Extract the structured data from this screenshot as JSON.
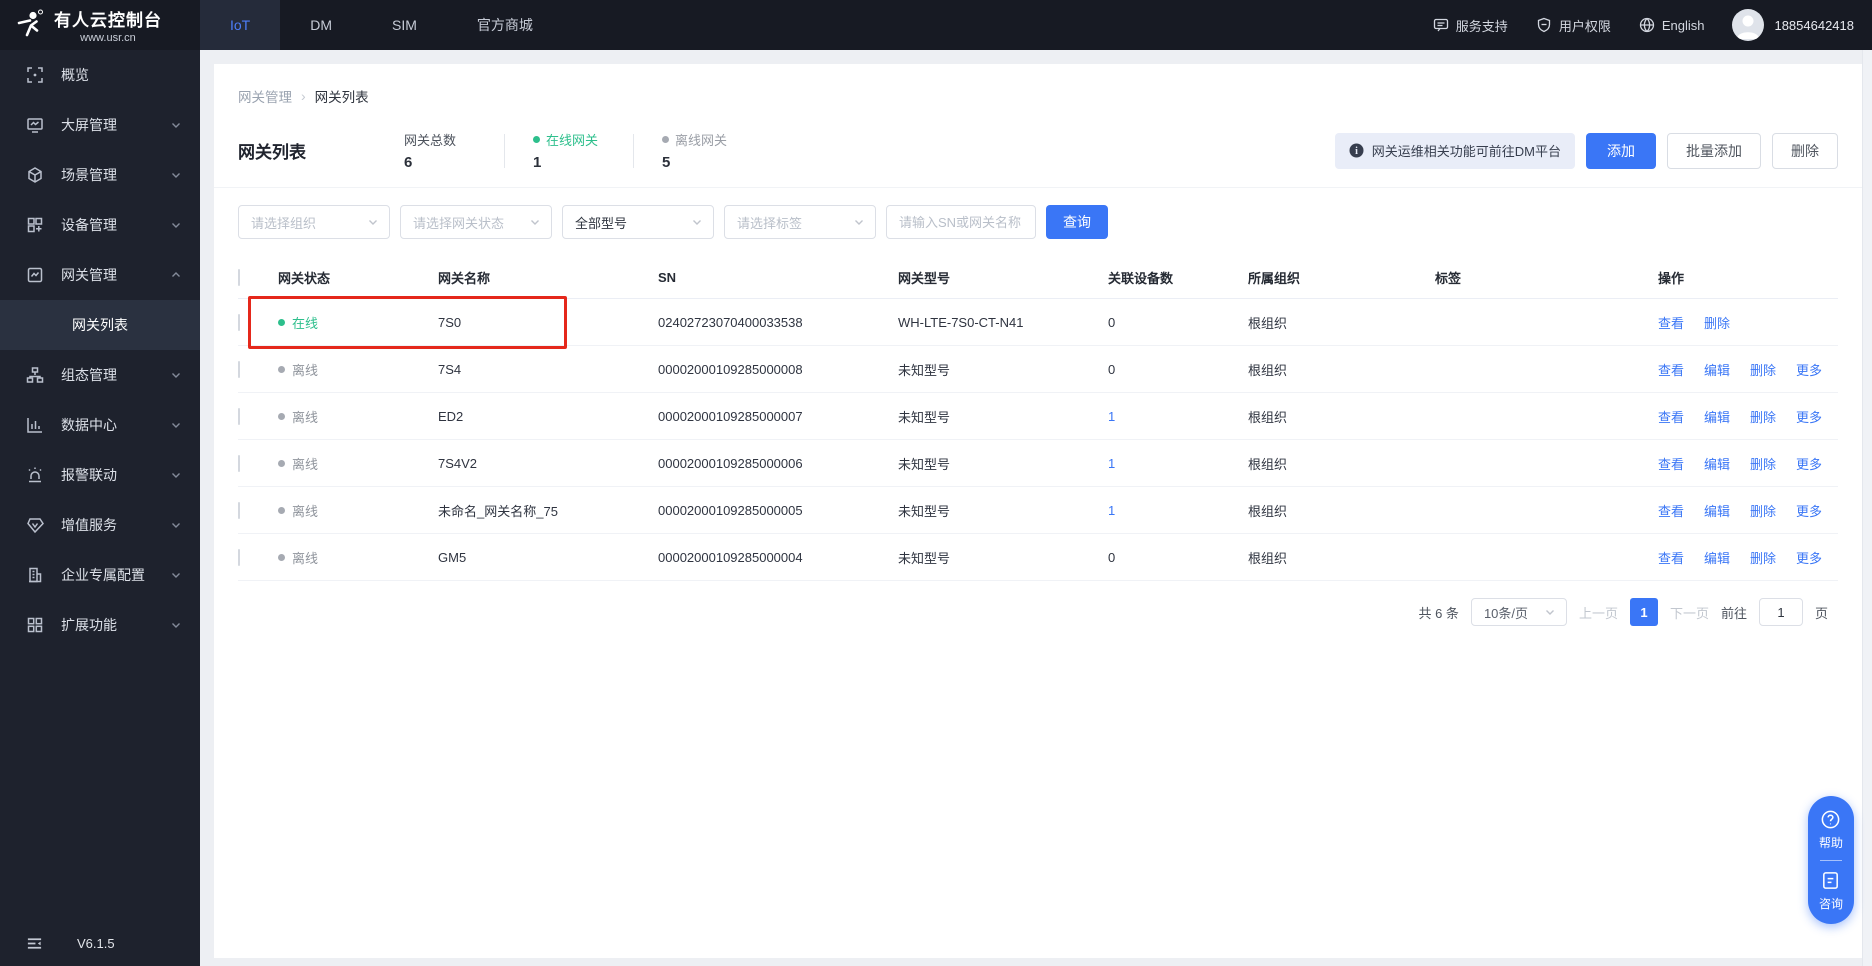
{
  "brand": {
    "title": "有人云控制台",
    "subtitle": "www.usr.cn"
  },
  "topbar": {
    "tabs": [
      {
        "name": "iot",
        "label": "IoT",
        "active": true
      },
      {
        "name": "dm",
        "label": "DM",
        "active": false
      },
      {
        "name": "sim",
        "label": "SIM",
        "active": false
      },
      {
        "name": "mall",
        "label": "官方商城",
        "active": false
      }
    ],
    "links": [
      {
        "name": "service-support",
        "icon": "chat-icon",
        "label": "服务支持"
      },
      {
        "name": "user-permission",
        "icon": "shield-icon",
        "label": "用户权限"
      },
      {
        "name": "language",
        "icon": "globe-icon",
        "label": "English"
      }
    ],
    "user_phone": "18854642418"
  },
  "sidebar": {
    "items": [
      {
        "name": "overview",
        "icon": "overview-icon",
        "label": "概览",
        "chevron": null,
        "submenu": false,
        "active": false
      },
      {
        "name": "screen-mgmt",
        "icon": "screen-icon",
        "label": "大屏管理",
        "chevron": "down",
        "submenu": false,
        "active": false
      },
      {
        "name": "scene-mgmt",
        "icon": "scene-icon",
        "label": "场景管理",
        "chevron": "down",
        "submenu": false,
        "active": false
      },
      {
        "name": "device-mgmt",
        "icon": "device-icon",
        "label": "设备管理",
        "chevron": "down",
        "submenu": false,
        "active": false
      },
      {
        "name": "gateway-mgmt",
        "icon": "gateway-icon",
        "label": "网关管理",
        "chevron": "up",
        "submenu": false,
        "active": false
      },
      {
        "name": "gateway-list",
        "icon": null,
        "label": "网关列表",
        "chevron": null,
        "submenu": true,
        "active": true
      },
      {
        "name": "config-mgmt",
        "icon": "topology-icon",
        "label": "组态管理",
        "chevron": "down",
        "submenu": false,
        "active": false
      },
      {
        "name": "data-center",
        "icon": "data-icon",
        "label": "数据中心",
        "chevron": "down",
        "submenu": false,
        "active": false
      },
      {
        "name": "alarm-linkage",
        "icon": "alarm-icon",
        "label": "报警联动",
        "chevron": "down",
        "submenu": false,
        "active": false
      },
      {
        "name": "value-added",
        "icon": "vas-icon",
        "label": "增值服务",
        "chevron": "down",
        "submenu": false,
        "active": false
      },
      {
        "name": "enterprise-config",
        "icon": "enterprise-icon",
        "label": "企业专属配置",
        "chevron": "down",
        "submenu": false,
        "active": false
      },
      {
        "name": "extensions",
        "icon": "extension-icon",
        "label": "扩展功能",
        "chevron": "down",
        "submenu": false,
        "active": false
      }
    ],
    "version": "V6.1.5"
  },
  "breadcrumb": {
    "parent": "网关管理",
    "current": "网关列表"
  },
  "page": {
    "title": "网关列表",
    "stats": [
      {
        "label": "网关总数",
        "value": "6",
        "dot": null,
        "label_color": "#4c525c"
      },
      {
        "label": "在线网关",
        "value": "1",
        "dot": "#2dbf8c",
        "label_color": "#2dbf8c"
      },
      {
        "label": "离线网关",
        "value": "5",
        "dot": "#a6aab2",
        "label_color": "#9a9ea6"
      }
    ],
    "banner_text": "网关运维相关功能可前往DM平台",
    "add_label": "添加",
    "batch_add_label": "批量添加",
    "delete_label": "删除"
  },
  "filters": {
    "selects": [
      {
        "name": "org-select",
        "value": "请选择组织",
        "is_placeholder": true
      },
      {
        "name": "status-select",
        "value": "请选择网关状态",
        "is_placeholder": true
      },
      {
        "name": "model-select",
        "value": "全部型号",
        "is_placeholder": false
      },
      {
        "name": "tag-select",
        "value": "请选择标签",
        "is_placeholder": true
      }
    ],
    "search_placeholder": "请输入SN或网关名称",
    "query_label": "查询"
  },
  "table": {
    "columns": [
      "网关状态",
      "网关名称",
      "SN",
      "网关型号",
      "关联设备数",
      "所属组织",
      "标签",
      "操作"
    ],
    "rows": [
      {
        "status": "在线",
        "online": true,
        "name": "7S0",
        "sn": "02402723070400033538",
        "model": "WH-LTE-7S0-CT-N41",
        "devices": "0",
        "devices_link": false,
        "org": "根组织",
        "tags": "",
        "actions": [
          "查看",
          "删除"
        ],
        "highlighted": true
      },
      {
        "status": "离线",
        "online": false,
        "name": "7S4",
        "sn": "00002000109285000008",
        "model": "未知型号",
        "devices": "0",
        "devices_link": false,
        "org": "根组织",
        "tags": "",
        "actions": [
          "查看",
          "编辑",
          "删除",
          "更多"
        ],
        "highlighted": false
      },
      {
        "status": "离线",
        "online": false,
        "name": "ED2",
        "sn": "00002000109285000007",
        "model": "未知型号",
        "devices": "1",
        "devices_link": true,
        "org": "根组织",
        "tags": "",
        "actions": [
          "查看",
          "编辑",
          "删除",
          "更多"
        ],
        "highlighted": false
      },
      {
        "status": "离线",
        "online": false,
        "name": "7S4V2",
        "sn": "00002000109285000006",
        "model": "未知型号",
        "devices": "1",
        "devices_link": true,
        "org": "根组织",
        "tags": "",
        "actions": [
          "查看",
          "编辑",
          "删除",
          "更多"
        ],
        "highlighted": false
      },
      {
        "status": "离线",
        "online": false,
        "name": "未命名_网关名称_75",
        "sn": "00002000109285000005",
        "model": "未知型号",
        "devices": "1",
        "devices_link": true,
        "org": "根组织",
        "tags": "",
        "actions": [
          "查看",
          "编辑",
          "删除",
          "更多"
        ],
        "highlighted": false
      },
      {
        "status": "离线",
        "online": false,
        "name": "GM5",
        "sn": "00002000109285000004",
        "model": "未知型号",
        "devices": "0",
        "devices_link": false,
        "org": "根组织",
        "tags": "",
        "actions": [
          "查看",
          "编辑",
          "删除",
          "更多"
        ],
        "highlighted": false
      }
    ]
  },
  "pagination": {
    "total": "共 6 条",
    "page_size": "10条/页",
    "prev": "上一页",
    "current": "1",
    "next": "下一页",
    "goto_label": "前往",
    "goto_value": "1",
    "page_label": "页"
  },
  "float_widget": {
    "help": "帮助",
    "consult": "咨询"
  },
  "colors": {
    "accent": "#3a76f6",
    "online": "#2dbf8c",
    "highlight": "#e5281b"
  }
}
